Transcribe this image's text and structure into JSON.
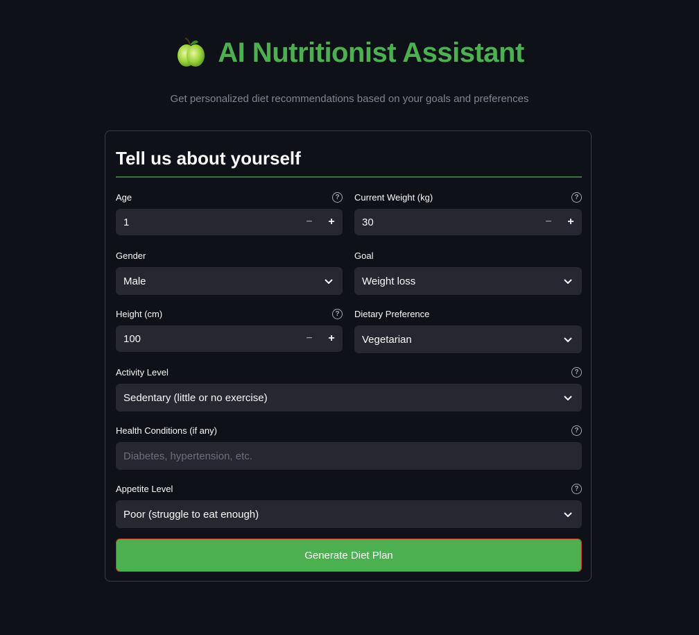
{
  "header": {
    "title": "AI Nutritionist Assistant",
    "subtitle": "Get personalized diet recommendations based on your goals and preferences",
    "icon": "green-apple-icon"
  },
  "form": {
    "heading": "Tell us about yourself",
    "accent_color": "#4caf50",
    "fields": {
      "age": {
        "label": "Age",
        "value": "1"
      },
      "weight": {
        "label": "Current Weight (kg)",
        "value": "30"
      },
      "gender": {
        "label": "Gender",
        "value": "Male"
      },
      "goal": {
        "label": "Goal",
        "value": "Weight loss"
      },
      "height": {
        "label": "Height (cm)",
        "value": "100"
      },
      "diet": {
        "label": "Dietary Preference",
        "value": "Vegetarian"
      },
      "activity": {
        "label": "Activity Level",
        "value": "Sedentary (little or no exercise)"
      },
      "health": {
        "label": "Health Conditions (if any)",
        "value": "",
        "placeholder": "Diabetes, hypertension, etc."
      },
      "appetite": {
        "label": "Appetite Level",
        "value": "Poor (struggle to eat enough)"
      }
    },
    "submit_label": "Generate Diet Plan"
  }
}
